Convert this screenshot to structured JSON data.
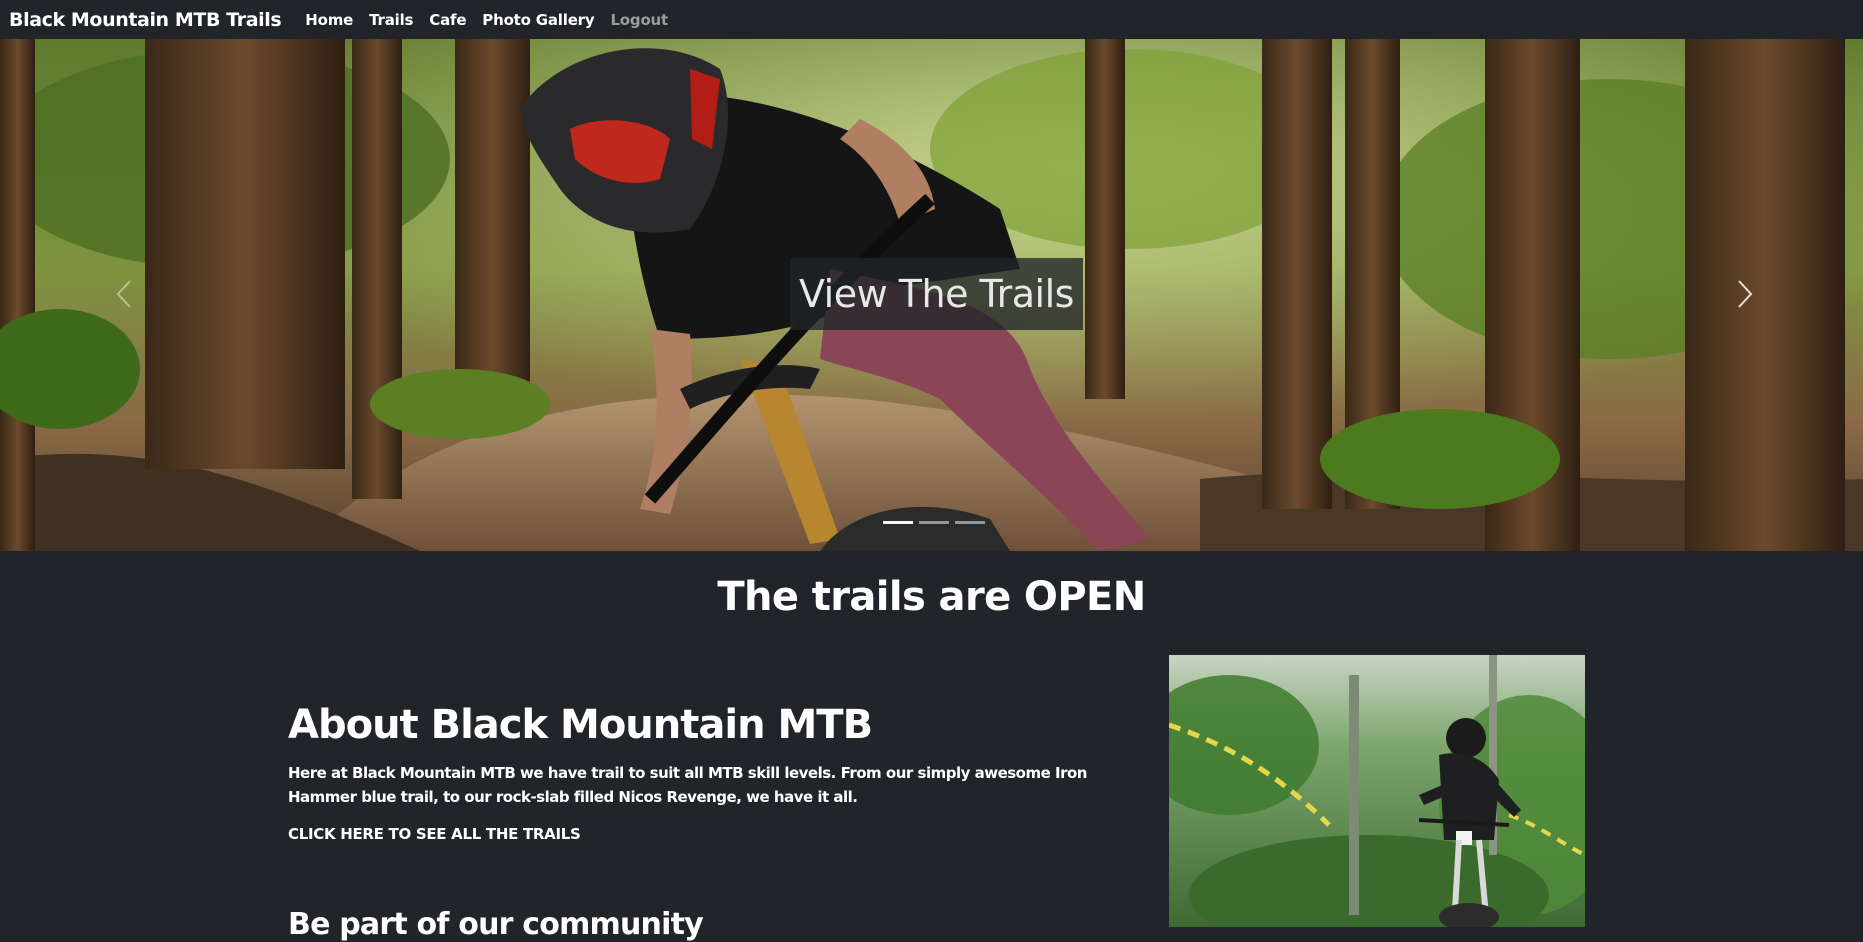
{
  "navbar": {
    "brand": "Black Mountain MTB Trails",
    "links": [
      {
        "label": "Home"
      },
      {
        "label": "Trails"
      },
      {
        "label": "Cafe"
      },
      {
        "label": "Photo Gallery"
      },
      {
        "label": "Logout"
      }
    ]
  },
  "hero": {
    "caption": "View The Trails",
    "prev_icon": "chevron-left-icon",
    "next_icon": "chevron-right-icon",
    "slides_count": 3,
    "active_slide": 1
  },
  "status": {
    "heading": "The trails are OPEN"
  },
  "about": {
    "title": "About Black Mountain MTB",
    "text": "Here at Black Mountain MTB we have trail to suit all MTB skill levels. From our simply awesome Iron Hammer blue trail, to our rock-slab filled Nicos Revenge, we have it all.",
    "link": "CLICK HERE TO SEE ALL THE TRAILS",
    "community_heading": "Be part of our community"
  },
  "colors": {
    "background": "#212529",
    "text": "#ffffff",
    "muted_nav": "#9a9da0"
  }
}
